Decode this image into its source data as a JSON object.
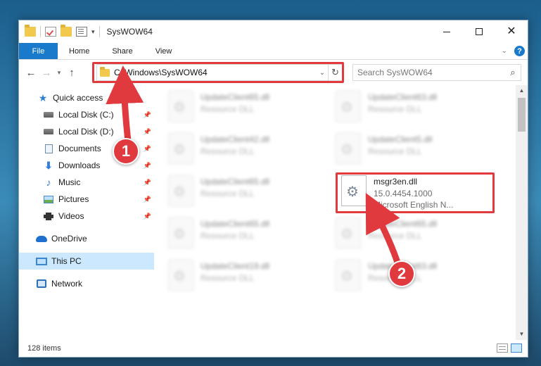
{
  "window": {
    "title": "SysWOW64"
  },
  "ribbon": {
    "tabs": [
      "File",
      "Home",
      "Share",
      "View"
    ]
  },
  "address": {
    "path": "C:\\Windows\\SysWOW64"
  },
  "search": {
    "placeholder": "Search SysWOW64"
  },
  "sidebar": {
    "quick_access": "Quick access",
    "items": [
      {
        "label": "Local Disk (C:)",
        "icon": "drive-icon"
      },
      {
        "label": "Local Disk (D:)",
        "icon": "drive-icon"
      },
      {
        "label": "Documents",
        "icon": "documents-icon"
      },
      {
        "label": "Downloads",
        "icon": "downloads-icon"
      },
      {
        "label": "Music",
        "icon": "music-icon"
      },
      {
        "label": "Pictures",
        "icon": "pictures-icon"
      },
      {
        "label": "Videos",
        "icon": "videos-icon"
      }
    ],
    "onedrive": "OneDrive",
    "this_pc": "This PC",
    "network": "Network"
  },
  "files": {
    "blurred": [
      {
        "name": "UpdateClient65.dll",
        "type": "Resource DLL"
      },
      {
        "name": "UpdateClient63.dll",
        "type": "Resource DLL"
      },
      {
        "name": "UpdateClient42.dll",
        "type": "Resource DLL"
      },
      {
        "name": "UpdateClient5.dll",
        "type": "Resource DLL"
      },
      {
        "name": "UpdateClient65.dll",
        "type": "Resource DLL"
      },
      {
        "name": "UpdateClient65.dll",
        "type": "Resource DLL"
      },
      {
        "name": "UpdateClient65.dll",
        "type": "Resource DLL"
      },
      {
        "name": "UpdateClient19.dll",
        "type": "Resource DLL"
      },
      {
        "name": "UpdateClient63.dll",
        "type": "Resource DLL"
      }
    ],
    "target": {
      "name": "msgr3en.dll",
      "version": "15.0.4454.1000",
      "description": "Microsoft English N..."
    }
  },
  "status": {
    "item_count": "128 items"
  },
  "annotations": {
    "step1": "1",
    "step2": "2",
    "color": "#e0393e"
  }
}
